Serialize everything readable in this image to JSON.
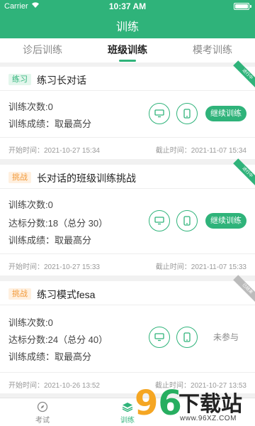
{
  "status_bar": {
    "carrier": "Carrier",
    "time": "10:37 AM"
  },
  "header": {
    "title": "训练"
  },
  "tabs": [
    {
      "label": "诊后训练",
      "active": false
    },
    {
      "label": "班级训练",
      "active": true
    },
    {
      "label": "模考训练",
      "active": false
    }
  ],
  "cards": [
    {
      "tag": "练习",
      "title": "练习长对话",
      "ribbon": "进行中",
      "count": "训练次数:0",
      "score": "训练成绩：取最高分",
      "action": "继续训练",
      "start": "开始时间：2021-10-27 15:34",
      "end": "截止时间：2021-11-07 15:34"
    },
    {
      "tag": "挑战",
      "title": "长对话的班级训练挑战",
      "ribbon": "进行中",
      "count": "训练次数:0",
      "target": "达标分数:18（总分 30）",
      "score": "训练成绩：取最高分",
      "action": "继续训练",
      "start": "开始时间：2021-10-27 15:33",
      "end": "截止时间：2021-11-07 15:33"
    },
    {
      "tag": "挑战",
      "title": "练习模式fesa",
      "ribbon": "已结束",
      "count": "训练次数:0",
      "target": "达标分数:24（总分 40）",
      "score": "训练成绩：取最高分",
      "action": "未参与",
      "start": "开始时间：2021-10-26 13:52",
      "end": "截止时间：2021-10-27 13:53"
    }
  ],
  "bottom_nav": [
    {
      "label": "考试",
      "icon": "compass-icon",
      "active": false
    },
    {
      "label": "训练",
      "icon": "layers-icon",
      "active": true
    }
  ],
  "watermark": {
    "digits_a": "9",
    "digits_b": "6",
    "text": "下载站",
    "url": "www.96XZ.COM"
  },
  "colors": {
    "primary": "#2fb37a",
    "challenge": "#f29a3a",
    "background": "#f1f1f1"
  }
}
